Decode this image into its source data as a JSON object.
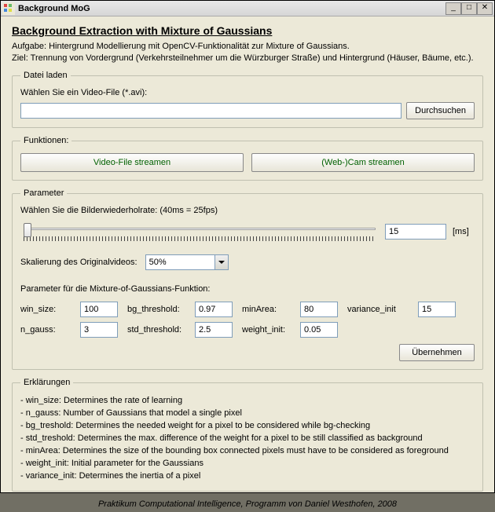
{
  "window": {
    "title": "Background MoG"
  },
  "header": {
    "title": "Background Extraction with Mixture of Gaussians",
    "task": "Aufgabe:  Hintergrund Modellierung mit OpenCV-Funktionalität  zur Mixture of Gaussians.",
    "goal": "Ziel: Trennung von Vordergrund (Verkehrsteilnehmer um die Würzburger Straße) und Hintergrund (Häuser, Bäume, etc.)."
  },
  "fileload": {
    "legend": "Datei laden",
    "label": "Wählen Sie ein Video-File (*.avi):",
    "value": "",
    "browse": "Durchsuchen"
  },
  "functions": {
    "legend": "Funktionen:",
    "stream_video": "Video-File streamen",
    "stream_cam": "(Web-)Cam streamen"
  },
  "parameter": {
    "legend": "Parameter",
    "fps_label": "Wählen Sie die Bilderwiederholrate: (40ms = 25fps)",
    "fps_value": "15",
    "fps_unit": "[ms]",
    "scale_label": "Skalierung des Originalvideos:",
    "scale_value": "50%",
    "mog_label": "Parameter für die Mixture-of-Gaussians-Funktion:",
    "fields": {
      "win_size_label": "win_size:",
      "win_size": "100",
      "bg_threshold_label": "bg_threshold:",
      "bg_threshold": "0.97",
      "minArea_label": "minArea:",
      "minArea": "80",
      "variance_init_label": "variance_init",
      "variance_init": "15",
      "n_gauss_label": "n_gauss:",
      "n_gauss": "3",
      "std_threshold_label": "std_threshold:",
      "std_threshold": "2.5",
      "weight_init_label": "weight_init:",
      "weight_init": "0.05"
    },
    "apply": "Übernehmen"
  },
  "explanations": {
    "legend": "Erklärungen",
    "items": [
      "win_size: Determines the rate of learning",
      "n_gauss: Number of Gaussians that model a single pixel",
      "bg_treshold: Determines the needed weight for a pixel to be considered while bg-checking",
      "std_treshold: Determines the max. difference of the weight for a pixel to be still classified as background",
      "minArea: Determines the size of the bounding box connected pixels must have to be considered as foreground",
      "weight_init: Initial parameter for the Gaussians",
      "variance_init: Determines the inertia of a pixel"
    ]
  },
  "footer": "Praktikum Computational Intelligence, Programm von Daniel Westhofen, 2008"
}
